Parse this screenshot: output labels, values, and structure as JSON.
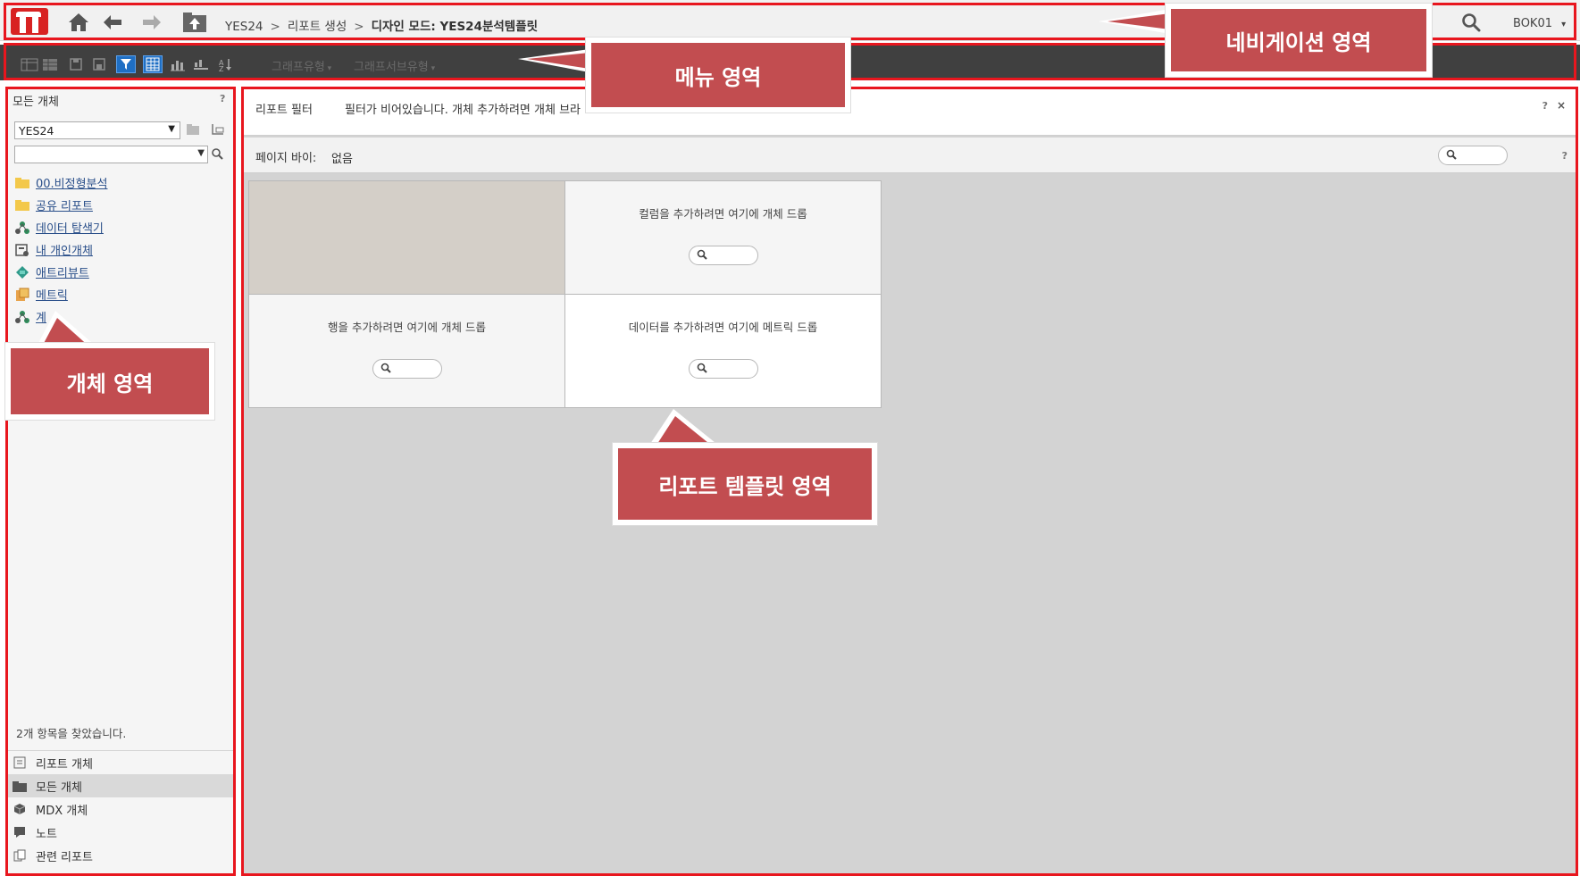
{
  "nav": {
    "breadcrumb": [
      "YES24",
      "리포트 생성",
      "디자인 모드: YES24분석템플릿"
    ],
    "separator": ">",
    "user": "BOK01",
    "user_arrow": "▾"
  },
  "toolbar": {
    "dropdowns": [
      "그래프유형",
      "그래프서브유형"
    ]
  },
  "object_panel": {
    "title": "모든 개체",
    "help": "?",
    "project": "YES24",
    "tree": [
      {
        "label": "00.비정형분석",
        "icon": "folder-icon"
      },
      {
        "label": "공유 리포트",
        "icon": "folder-icon"
      },
      {
        "label": "데이터 탐색기",
        "icon": "hierarchy-icon"
      },
      {
        "label": "내 개인개체",
        "icon": "personal-objects-icon"
      },
      {
        "label": "애트리뷰트",
        "icon": "attribute-icon"
      },
      {
        "label": "메트릭",
        "icon": "metric-icon"
      },
      {
        "label": "계",
        "icon": "hierarchy-icon"
      }
    ],
    "found_text": "2개 항목을 찾았습니다.",
    "shortcuts": [
      {
        "label": "리포트 개체",
        "icon": "report-object-icon",
        "selected": false
      },
      {
        "label": "모든 개체",
        "icon": "folder-icon",
        "selected": true
      },
      {
        "label": "MDX 개체",
        "icon": "cube-icon",
        "selected": false
      },
      {
        "label": "노트",
        "icon": "note-icon",
        "selected": false
      },
      {
        "label": "관련 리포트",
        "icon": "related-report-icon",
        "selected": false
      }
    ]
  },
  "report": {
    "filter_label": "리포트 필터",
    "filter_message": "필터가 비어있습니다. 개체 추가하려면 개체 브라",
    "help": "?",
    "close": "×",
    "page_by_label": "페이지 바이:",
    "page_by_value": "없음",
    "column_hint": "컬럼을 추가하려면 여기에 개체 드롭",
    "row_hint": "행을 추가하려면 여기에 개체 드롭",
    "data_hint": "데이터를 추가하려면 여기에 메트릭 드롭"
  },
  "annotations": {
    "navigation": "네비게이션 영역",
    "menu": "메뉴 영역",
    "object": "개체 영역",
    "template": "리포트 템플릿 영역"
  },
  "colors": {
    "annotation_border": "#e8161e",
    "callout_fill": "#c24d50",
    "logo_red": "#d82222",
    "toolbar_bg": "#404040",
    "report_bg": "#d3d3d3"
  }
}
